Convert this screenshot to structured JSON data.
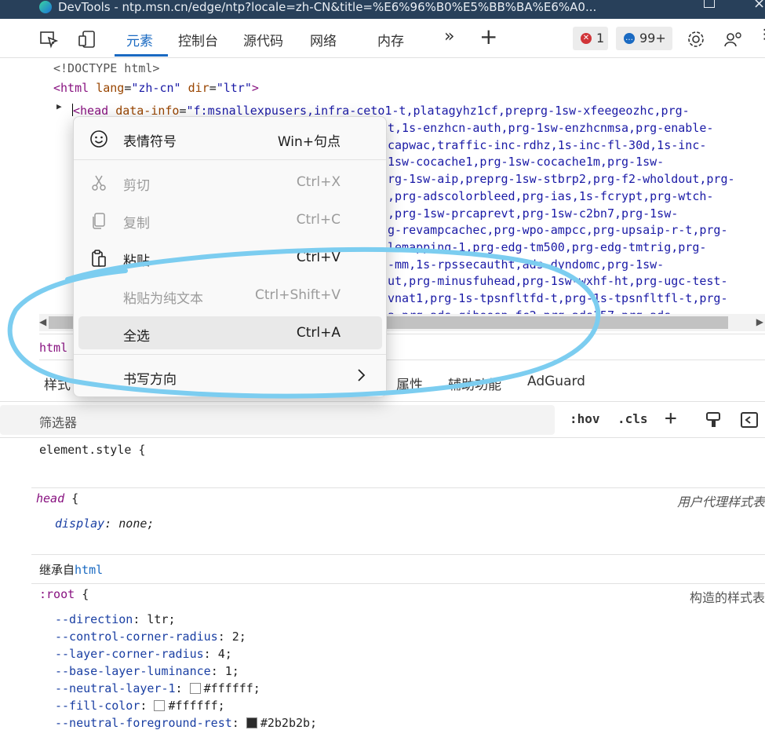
{
  "titlebar": {
    "title": "DevTools - ntp.msn.cn/edge/ntp?locale=zh-CN&title=%E6%96%B0%E5%BB%BA%E6%A0..."
  },
  "toolbar": {
    "tabs": [
      "元素",
      "控制台",
      "源代码",
      "网络",
      "内存"
    ],
    "more": "»",
    "add": "+",
    "error_count": "1",
    "issue_count": "99+"
  },
  "dom": {
    "doctype": "<!DOCTYPE html>",
    "html_tag": "<html",
    "html_lang_attr": "lang",
    "html_lang_val": "\"zh-cn\"",
    "html_dir_attr": "dir",
    "html_dir_val": "\"ltr\"",
    "html_close": ">",
    "head_tag": "<head",
    "head_attr": "data-info",
    "head_first": "\"f:msnallexpusers,infra-ceto1-t,platagyhz1cf,preprg-1sw-xfeegeozhc,prg-",
    "wrapped_lines": [
      "t,1s-enzhcn-auth,prg-1sw-enzhcnmsa,prg-enable-",
      "capwac,traffic-inc-rdhz,1s-inc-fl-30d,1s-inc-",
      "1sw-cocache1,prg-1sw-cocache1m,prg-1sw-",
      "rg-1sw-aip,preprg-1sw-stbrp2,prg-f2-wholdout,prg-",
      ",prg-adscolorbleed,prg-ias,1s-fcrypt,prg-wtch-",
      ",prg-1sw-prcaprevt,prg-1sw-c2bn7,prg-1sw-",
      "g-revampcachec,prg-wpo-ampcc,prg-upsaip-r-t,prg-",
      "lemapping-1,prg-edg-tm500,prg-edg-tmtrig,prg-",
      "-mm,1s-rpssecautht,ads-dyndomc,prg-1sw-",
      "ut,prg-minusfuhead,prg-1sw-wxhf-ht,prg-ugc-test-",
      "vnat1,prg-1s-tpsnfltfd-t,prg-1s-tpsnfltfl-t,prg-",
      "a prg-ads-qiboosp-fc2 prg-ads157 prg-ads"
    ]
  },
  "breadcrumb": "html",
  "subtabs": [
    "样式",
    "属性",
    "辅助功能",
    "AdGuard"
  ],
  "filter": {
    "placeholder": "筛选器",
    "hov": ":hov",
    "cls": ".cls",
    "add": "+"
  },
  "styles": {
    "element_style": "element.style {",
    "head_selector": "head",
    "head_brace": "{",
    "head_source": "用户代理样式表",
    "display_prop": "display",
    "display_val": "none;",
    "inherited_label": "继承自",
    "inherited_tag": "html",
    "root_selector": ":root",
    "root_brace": "{",
    "root_source": "构造的样式表",
    "root_props": [
      {
        "name": "--direction",
        "value": "ltr;",
        "swatch": ""
      },
      {
        "name": "--control-corner-radius",
        "value": "2;",
        "swatch": ""
      },
      {
        "name": "--layer-corner-radius",
        "value": "4;",
        "swatch": ""
      },
      {
        "name": "--base-layer-luminance",
        "value": "1;",
        "swatch": ""
      },
      {
        "name": "--neutral-layer-1",
        "value": "#ffffff;",
        "swatch": "#ffffff"
      },
      {
        "name": "--fill-color",
        "value": "#ffffff;",
        "swatch": "#ffffff"
      },
      {
        "name": "--neutral-foreground-rest",
        "value": "#2b2b2b;",
        "swatch": "#2b2b2b"
      }
    ]
  },
  "context_menu": {
    "items": [
      {
        "icon": "emoji-icon",
        "label": "表情符号",
        "shortcut": "Win+句点",
        "disabled": false
      },
      {
        "icon": "scissors-icon",
        "label": "剪切",
        "shortcut": "Ctrl+X",
        "disabled": true
      },
      {
        "icon": "copy-icon",
        "label": "复制",
        "shortcut": "Ctrl+C",
        "disabled": true
      },
      {
        "icon": "clipboard-icon",
        "label": "粘贴",
        "shortcut": "Ctrl+V",
        "disabled": false
      },
      {
        "icon": "",
        "label": "粘贴为纯文本",
        "shortcut": "Ctrl+Shift+V",
        "disabled": true
      },
      {
        "icon": "",
        "label": "全选",
        "shortcut": "Ctrl+A",
        "disabled": false,
        "highlighted": true
      },
      {
        "icon": "",
        "label": "书写方向",
        "shortcut": "",
        "disabled": false,
        "submenu": true
      }
    ]
  },
  "colors": {
    "accent": "#1a6ac2",
    "annotation": "#7ccdf0",
    "error": "#d13438",
    "issue": "#1a6ac2"
  }
}
